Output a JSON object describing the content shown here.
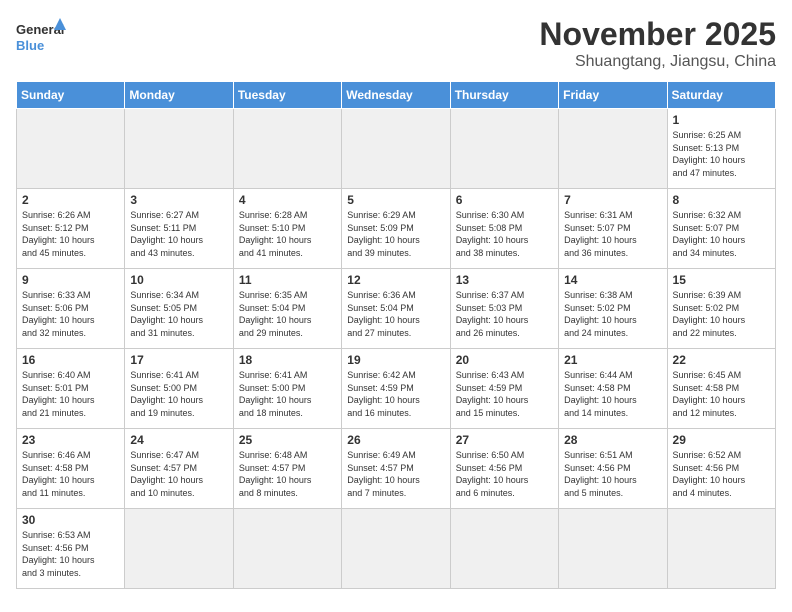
{
  "header": {
    "logo_general": "General",
    "logo_blue": "Blue",
    "month": "November 2025",
    "location": "Shuangtang, Jiangsu, China"
  },
  "days_of_week": [
    "Sunday",
    "Monday",
    "Tuesday",
    "Wednesday",
    "Thursday",
    "Friday",
    "Saturday"
  ],
  "weeks": [
    [
      {
        "day": "",
        "info": ""
      },
      {
        "day": "",
        "info": ""
      },
      {
        "day": "",
        "info": ""
      },
      {
        "day": "",
        "info": ""
      },
      {
        "day": "",
        "info": ""
      },
      {
        "day": "",
        "info": ""
      },
      {
        "day": "1",
        "info": "Sunrise: 6:25 AM\nSunset: 5:13 PM\nDaylight: 10 hours\nand 47 minutes."
      }
    ],
    [
      {
        "day": "2",
        "info": "Sunrise: 6:26 AM\nSunset: 5:12 PM\nDaylight: 10 hours\nand 45 minutes."
      },
      {
        "day": "3",
        "info": "Sunrise: 6:27 AM\nSunset: 5:11 PM\nDaylight: 10 hours\nand 43 minutes."
      },
      {
        "day": "4",
        "info": "Sunrise: 6:28 AM\nSunset: 5:10 PM\nDaylight: 10 hours\nand 41 minutes."
      },
      {
        "day": "5",
        "info": "Sunrise: 6:29 AM\nSunset: 5:09 PM\nDaylight: 10 hours\nand 39 minutes."
      },
      {
        "day": "6",
        "info": "Sunrise: 6:30 AM\nSunset: 5:08 PM\nDaylight: 10 hours\nand 38 minutes."
      },
      {
        "day": "7",
        "info": "Sunrise: 6:31 AM\nSunset: 5:07 PM\nDaylight: 10 hours\nand 36 minutes."
      },
      {
        "day": "8",
        "info": "Sunrise: 6:32 AM\nSunset: 5:07 PM\nDaylight: 10 hours\nand 34 minutes."
      }
    ],
    [
      {
        "day": "9",
        "info": "Sunrise: 6:33 AM\nSunset: 5:06 PM\nDaylight: 10 hours\nand 32 minutes."
      },
      {
        "day": "10",
        "info": "Sunrise: 6:34 AM\nSunset: 5:05 PM\nDaylight: 10 hours\nand 31 minutes."
      },
      {
        "day": "11",
        "info": "Sunrise: 6:35 AM\nSunset: 5:04 PM\nDaylight: 10 hours\nand 29 minutes."
      },
      {
        "day": "12",
        "info": "Sunrise: 6:36 AM\nSunset: 5:04 PM\nDaylight: 10 hours\nand 27 minutes."
      },
      {
        "day": "13",
        "info": "Sunrise: 6:37 AM\nSunset: 5:03 PM\nDaylight: 10 hours\nand 26 minutes."
      },
      {
        "day": "14",
        "info": "Sunrise: 6:38 AM\nSunset: 5:02 PM\nDaylight: 10 hours\nand 24 minutes."
      },
      {
        "day": "15",
        "info": "Sunrise: 6:39 AM\nSunset: 5:02 PM\nDaylight: 10 hours\nand 22 minutes."
      }
    ],
    [
      {
        "day": "16",
        "info": "Sunrise: 6:40 AM\nSunset: 5:01 PM\nDaylight: 10 hours\nand 21 minutes."
      },
      {
        "day": "17",
        "info": "Sunrise: 6:41 AM\nSunset: 5:00 PM\nDaylight: 10 hours\nand 19 minutes."
      },
      {
        "day": "18",
        "info": "Sunrise: 6:41 AM\nSunset: 5:00 PM\nDaylight: 10 hours\nand 18 minutes."
      },
      {
        "day": "19",
        "info": "Sunrise: 6:42 AM\nSunset: 4:59 PM\nDaylight: 10 hours\nand 16 minutes."
      },
      {
        "day": "20",
        "info": "Sunrise: 6:43 AM\nSunset: 4:59 PM\nDaylight: 10 hours\nand 15 minutes."
      },
      {
        "day": "21",
        "info": "Sunrise: 6:44 AM\nSunset: 4:58 PM\nDaylight: 10 hours\nand 14 minutes."
      },
      {
        "day": "22",
        "info": "Sunrise: 6:45 AM\nSunset: 4:58 PM\nDaylight: 10 hours\nand 12 minutes."
      }
    ],
    [
      {
        "day": "23",
        "info": "Sunrise: 6:46 AM\nSunset: 4:58 PM\nDaylight: 10 hours\nand 11 minutes."
      },
      {
        "day": "24",
        "info": "Sunrise: 6:47 AM\nSunset: 4:57 PM\nDaylight: 10 hours\nand 10 minutes."
      },
      {
        "day": "25",
        "info": "Sunrise: 6:48 AM\nSunset: 4:57 PM\nDaylight: 10 hours\nand 8 minutes."
      },
      {
        "day": "26",
        "info": "Sunrise: 6:49 AM\nSunset: 4:57 PM\nDaylight: 10 hours\nand 7 minutes."
      },
      {
        "day": "27",
        "info": "Sunrise: 6:50 AM\nSunset: 4:56 PM\nDaylight: 10 hours\nand 6 minutes."
      },
      {
        "day": "28",
        "info": "Sunrise: 6:51 AM\nSunset: 4:56 PM\nDaylight: 10 hours\nand 5 minutes."
      },
      {
        "day": "29",
        "info": "Sunrise: 6:52 AM\nSunset: 4:56 PM\nDaylight: 10 hours\nand 4 minutes."
      }
    ],
    [
      {
        "day": "30",
        "info": "Sunrise: 6:53 AM\nSunset: 4:56 PM\nDaylight: 10 hours\nand 3 minutes."
      },
      {
        "day": "",
        "info": ""
      },
      {
        "day": "",
        "info": ""
      },
      {
        "day": "",
        "info": ""
      },
      {
        "day": "",
        "info": ""
      },
      {
        "day": "",
        "info": ""
      },
      {
        "day": "",
        "info": ""
      }
    ]
  ]
}
